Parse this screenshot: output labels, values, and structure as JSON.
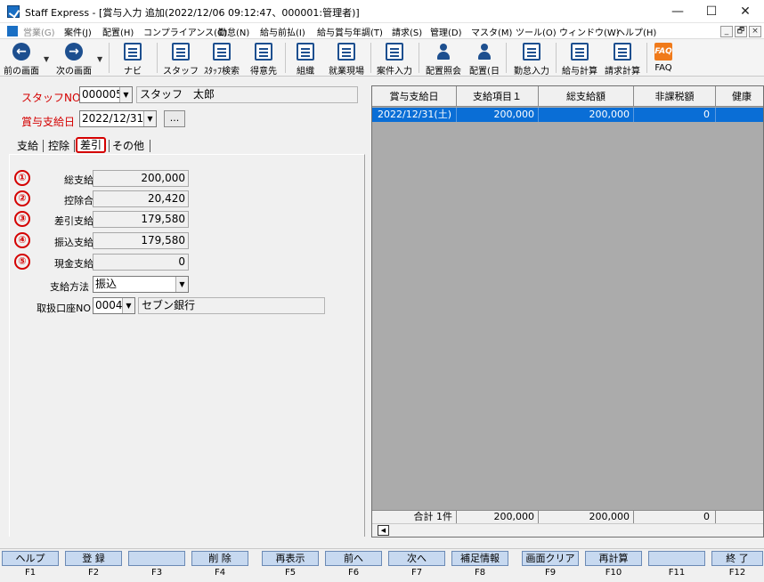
{
  "window": {
    "title": "Staff Express - [賞与入力 追加(2022/12/06 09:12:47、000001:管理者)]",
    "controls": [
      "—",
      "☐",
      "✕"
    ]
  },
  "menu": {
    "items": [
      "営業(G)",
      "案件(J)",
      "配置(H)",
      "コンプライアンス(C)",
      "勤怠(N)",
      "給与前払(I)",
      "給与賞与年調(T)",
      "請求(S)",
      "管理(D)",
      "マスタ(M)",
      "ツール(O)",
      "ウィンドウ(W)",
      "ヘルプ(H)"
    ],
    "mdi_controls": [
      "_",
      "🗗",
      "×"
    ]
  },
  "toolbar": {
    "buttons": [
      {
        "label": "前の画面",
        "icon": "←"
      },
      {
        "label": "次の画面",
        "icon": "→"
      },
      {
        "label": "ナビ"
      },
      {
        "label": "スタッフ"
      },
      {
        "label": "ｽﾀｯﾌ検索"
      },
      {
        "label": "得意先"
      },
      {
        "label": "組織"
      },
      {
        "label": "就業現場"
      },
      {
        "label": "案件入力"
      },
      {
        "label": "配置照会"
      },
      {
        "label": "配置(日"
      },
      {
        "label": "勤怠入力"
      },
      {
        "label": "給与計算"
      },
      {
        "label": "請求計算"
      },
      {
        "label": "FAQ",
        "icon": "FAQ"
      }
    ],
    "dropdown_arrow": "▼"
  },
  "form": {
    "staff_no_label": "スタッフNO",
    "staff_no_value": "000005",
    "staff_name": "スタッフ　太郎",
    "payment_date_label": "賞与支給日",
    "payment_date_value": "2022/12/31",
    "ellipsis_label": "...",
    "dropdown_arrow": "▼"
  },
  "tabs": [
    "支給",
    "控除",
    "差引",
    "その他"
  ],
  "sagaku": {
    "rows": [
      {
        "num": "①",
        "label": "総支給額",
        "value": "200,000"
      },
      {
        "num": "②",
        "label": "控除合計",
        "value": "20,420"
      },
      {
        "num": "③",
        "label": "差引支給額",
        "value": "179,580"
      },
      {
        "num": "④",
        "label": "振込支給額",
        "value": "179,580"
      },
      {
        "num": "⑤",
        "label": "現金支給額",
        "value": "0"
      }
    ],
    "pay_method_label": "支給方法",
    "pay_method_value": "振込",
    "account_label": "取扱口座NO",
    "account_no": "0004",
    "bank_name": "セブン銀行"
  },
  "grid": {
    "headers": [
      "賞与支給日",
      "支給項目１",
      "総支給額",
      "非課税額",
      "健康"
    ],
    "row": [
      "2022/12/31(土)",
      "200,000",
      "200,000",
      "0"
    ],
    "footer_label": "合計 1件",
    "footer": [
      "200,000",
      "200,000",
      "0"
    ],
    "scroll_left": "◀"
  },
  "fkeys": [
    {
      "label": "ヘルプ",
      "key": "F1"
    },
    {
      "label": "登 録",
      "key": "F2"
    },
    {
      "label": "",
      "key": "F3"
    },
    {
      "label": "削 除",
      "key": "F4"
    },
    {
      "label": "再表示",
      "key": "F5"
    },
    {
      "label": "前へ",
      "key": "F6"
    },
    {
      "label": "次へ",
      "key": "F7"
    },
    {
      "label": "補足情報",
      "key": "F8"
    },
    {
      "label": "画面クリア",
      "key": "F9"
    },
    {
      "label": "再計算",
      "key": "F10"
    },
    {
      "label": "",
      "key": "F11"
    },
    {
      "label": "終 了",
      "key": "F12"
    }
  ]
}
